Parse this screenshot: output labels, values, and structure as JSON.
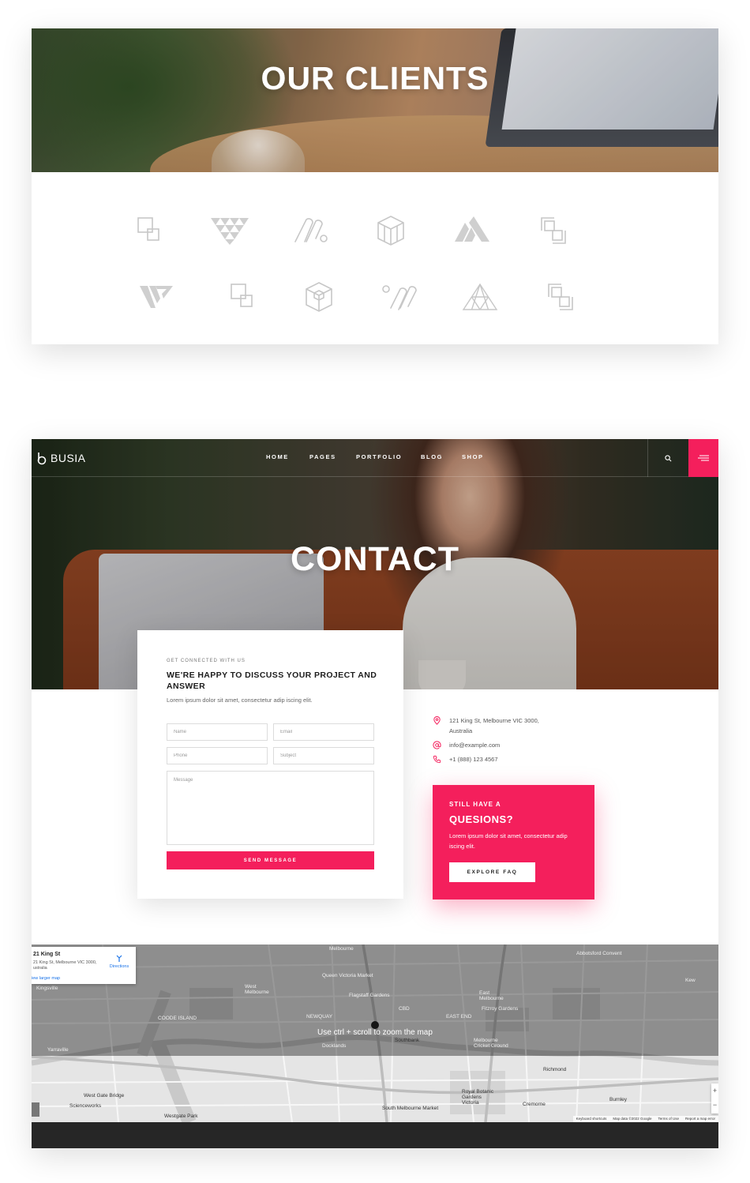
{
  "clients": {
    "title": "OUR CLIENTS",
    "logos": [
      "squares-logo-icon",
      "triangles-logo-icon",
      "m-swirl-logo-icon",
      "cube-logo-icon",
      "a-stripes-logo-icon",
      "corner-squares-logo-icon",
      "w-logo-icon",
      "squares-logo-icon",
      "hex-cube-logo-icon",
      "w-swirl-logo-icon",
      "triangle-grid-logo-icon",
      "corner-squares-logo-icon"
    ]
  },
  "header": {
    "brand": "BUSIA",
    "menu": [
      "HOME",
      "PAGES",
      "PORTFOLIO",
      "BLOG",
      "SHOP"
    ],
    "accent": "#f41f5c"
  },
  "contact": {
    "title": "CONTACT",
    "form": {
      "eyebrow": "GET CONNECTED WITH US",
      "heading": "WE'RE HAPPY TO DISCUSS YOUR PROJECT AND ANSWER",
      "lead": "Lorem ipsum dolor sit amet, consectetur adip iscing elit.",
      "name_placeholder": "Name",
      "email_placeholder": "Email",
      "phone_placeholder": "Phone",
      "subject_placeholder": "Subject",
      "message_placeholder": "Message",
      "send_label": "SEND MESSAGE"
    },
    "info": {
      "address_line1": "121 King St, Melbourne VIC 3000,",
      "address_line2": "Australia",
      "email": "info@example.com",
      "phone": "+1 (888) 123 4567"
    },
    "faq": {
      "eyebrow": "STILL HAVE A",
      "title": "QUESIONS?",
      "text": "Lorem ipsum dolor sit amet, consectetur adip iscing elit.",
      "button": "EXPLORE FAQ"
    }
  },
  "map": {
    "hint": "Use ctrl + scroll to zoom the map",
    "popup_title": "21 King St",
    "popup_address": "21 King St, Melbourne VIC 3000, ustralia",
    "directions": "Directions",
    "larger_map": "iew larger map",
    "labels": {
      "melbourne": "Melbourne",
      "west_melbourne": "West\nMelbourne",
      "kingsville": "Kingsville",
      "abbotsford": "Abbotsford Convent",
      "east_melbourne": "East\nMelbourne",
      "richmond": "Richmond",
      "cremorne": "Cremorne",
      "burnley": "Burnley",
      "docklands": "Docklands",
      "yarraville": "Yarraville",
      "cbd": "CBD",
      "southbank": "Southbank",
      "newquay": "NEWQUAY",
      "east_end": "EAST END",
      "coode_island": "COODE ISLAND",
      "kew": "Kew",
      "victoria_market": "Queen Victoria Market",
      "royal_botanic": "Royal Botanic\nGardens\nVictoria",
      "south_melbourne_market": "South Melbourne Market",
      "fitzroy_gardens": "Fitzroy Gardens",
      "flagstaff": "Flagstaff Gardens",
      "mcg": "Melbourne\nCricket Ground",
      "spotswood": "Scienceworks",
      "west_gate": "West Gate Bridge",
      "westgate_park": "Westgate Park"
    },
    "footer": [
      "Keyboard shortcuts",
      "Map data ©2022 Google",
      "Terms of Use",
      "Report a map error"
    ],
    "zoom_in": "+",
    "zoom_out": "−"
  }
}
